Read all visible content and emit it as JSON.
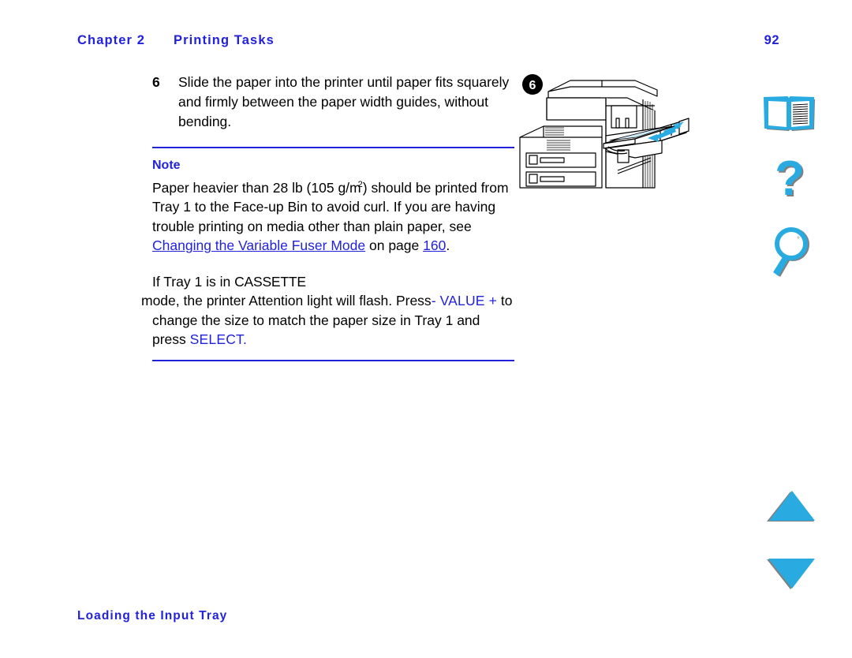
{
  "header": {
    "chapter_label": "Chapter 2",
    "chapter_title": "Printing Tasks",
    "page_number": "92"
  },
  "steps": [
    {
      "number": "6",
      "text": "Slide the paper into the printer until paper fits squarely and firmly between the paper width guides, without bending."
    }
  ],
  "note": {
    "label": "Note",
    "paragraph_1": {
      "part_1": "Paper heavier than 28 lb (105 g/m",
      "superscript": "2",
      "part_2": ") should be printed from Tray 1 to the Face-up Bin to avoid curl. If you are having trouble printing on media other than plain paper, see ",
      "link_1": "Changing the Variable Fuser Mode",
      "part_3": " on page ",
      "link_2": "160",
      "part_4": "."
    },
    "paragraph_2": {
      "part_1": "If Tray 1 is in ",
      "cassette_label": "CASSETTE",
      "part_2": " mode, the printer Attention light will flash. Press ",
      "minus": "-",
      "value_label": "VALUE",
      "plus": "+",
      "part_3": " to change the size to match the paper size in Tray 1 and press ",
      "select_label": "SELECT",
      "part_4": "."
    }
  },
  "illustration": {
    "name": "printer-tray-1-loading-diagram",
    "callout_number": "6",
    "alt": "Printer with Tray 1 open and paper being slid in, arrow showing insertion direction"
  },
  "nav_icons": [
    {
      "name": "book-icon",
      "label": "Contents"
    },
    {
      "name": "question-mark-icon",
      "label": "Help"
    },
    {
      "name": "magnifier-icon",
      "label": "Search"
    },
    {
      "name": "triangle-up-icon",
      "label": "Previous Page"
    },
    {
      "name": "triangle-down-icon",
      "label": "Next Page"
    }
  ],
  "footer": {
    "section_title": "Loading the Input Tray"
  },
  "colors": {
    "link_blue": "#2222dd",
    "icon_cyan": "#29ABE2",
    "icon_shadow": "#808080",
    "paper_blue": "#CCE6F4",
    "text_black": "#000000"
  }
}
